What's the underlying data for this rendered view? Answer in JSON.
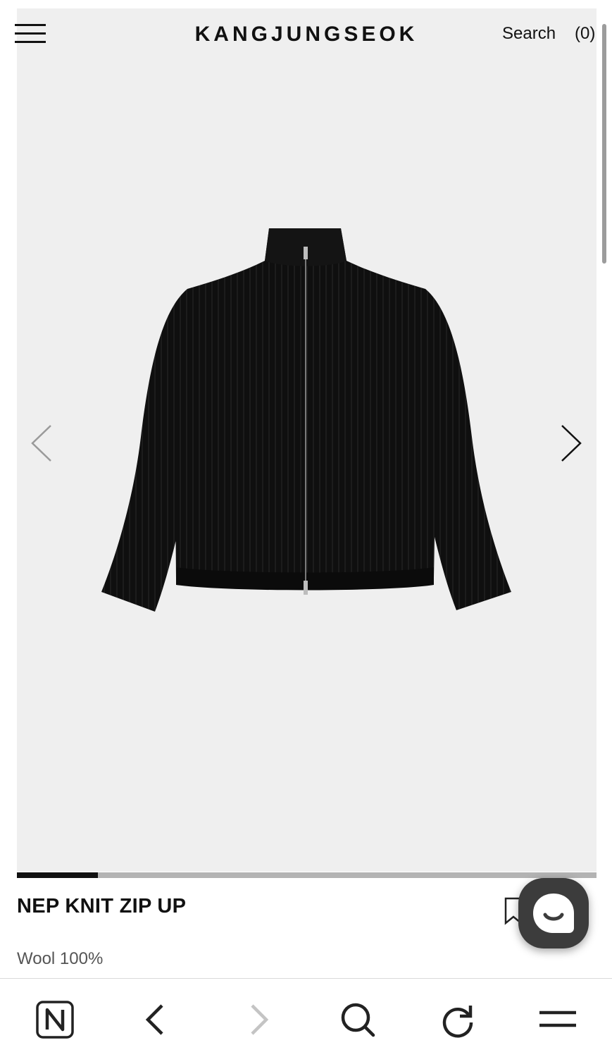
{
  "header": {
    "brand": "KANGJUNGSEOK",
    "search_label": "Search",
    "cart_label": "(0)",
    "menu_icon": "hamburger-menu-icon"
  },
  "gallery": {
    "prev_icon": "chevron-left-icon",
    "next_icon": "chevron-right-icon",
    "progress_fraction": 0.14
  },
  "product": {
    "name": "NEP KNIT ZIP UP",
    "material": "Wool 100%",
    "bookmark_icon": "bookmark-icon",
    "chat_icon": "chat-bubble-icon"
  },
  "toolbar": {
    "items": [
      {
        "icon": "naver-n-icon"
      },
      {
        "icon": "back-arrow-icon"
      },
      {
        "icon": "forward-arrow-icon"
      },
      {
        "icon": "search-icon"
      },
      {
        "icon": "refresh-icon"
      },
      {
        "icon": "menu-icon"
      }
    ]
  },
  "colors": {
    "hero_background": "#efefef",
    "garment": "#111111",
    "chat_button": "#3c3c3c",
    "progress_fill": "#111111",
    "progress_track": "#b3b3b3"
  }
}
